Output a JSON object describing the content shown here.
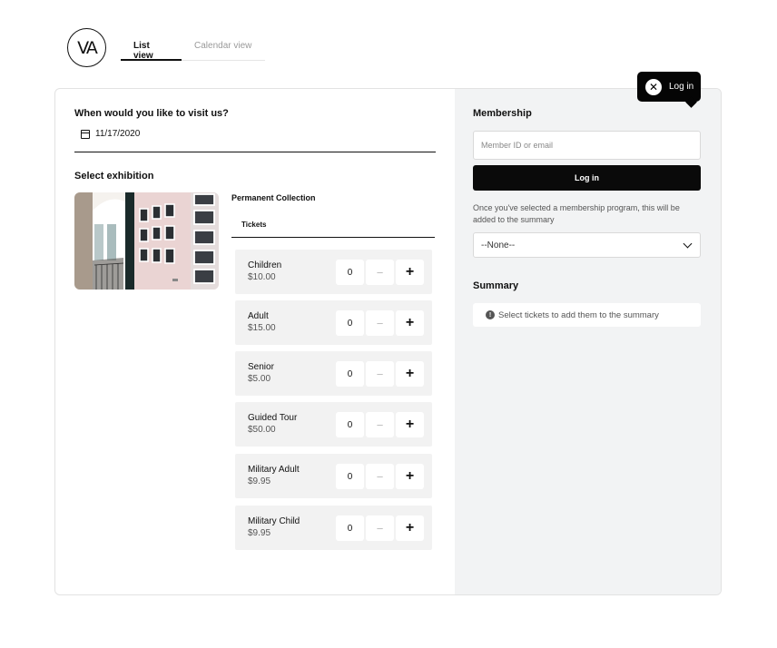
{
  "brand": {
    "logo_text": "VA"
  },
  "tabs": [
    {
      "label": "List view",
      "active": true
    },
    {
      "label": "Calendar view",
      "active": false
    }
  ],
  "visit": {
    "question": "When would you like to visit us?",
    "date": "11/17/2020",
    "date_icon": "calendar-icon"
  },
  "exhibition": {
    "heading": "Select exhibition",
    "name": "Permanent Collection",
    "tickets_tab": "Tickets"
  },
  "tickets": [
    {
      "name": "Children",
      "price": "$10.00",
      "qty": "0"
    },
    {
      "name": "Adult",
      "price": "$15.00",
      "qty": "0"
    },
    {
      "name": "Senior",
      "price": "$5.00",
      "qty": "0"
    },
    {
      "name": "Guided Tour",
      "price": "$50.00",
      "qty": "0"
    },
    {
      "name": "Military Adult",
      "price": "$9.95",
      "qty": "0"
    },
    {
      "name": "Military Child",
      "price": "$9.95",
      "qty": "0"
    }
  ],
  "stepper": {
    "minus": "−",
    "plus": "+"
  },
  "membership": {
    "heading": "Membership",
    "placeholder": "Member ID or email",
    "login_button": "Log in",
    "note": "Once you've selected a membership program, this will be added to the summary",
    "select_value": "--None--"
  },
  "summary": {
    "heading": "Summary",
    "empty_message": "Select tickets to add them to the summary",
    "info_icon": "!"
  },
  "tooltip": {
    "label": "Log in",
    "close_icon": "✕"
  },
  "colors": {
    "panel_bg": "#f2f3f4",
    "ticket_bg": "#f2f2f2",
    "primary": "#0a0a0a"
  }
}
